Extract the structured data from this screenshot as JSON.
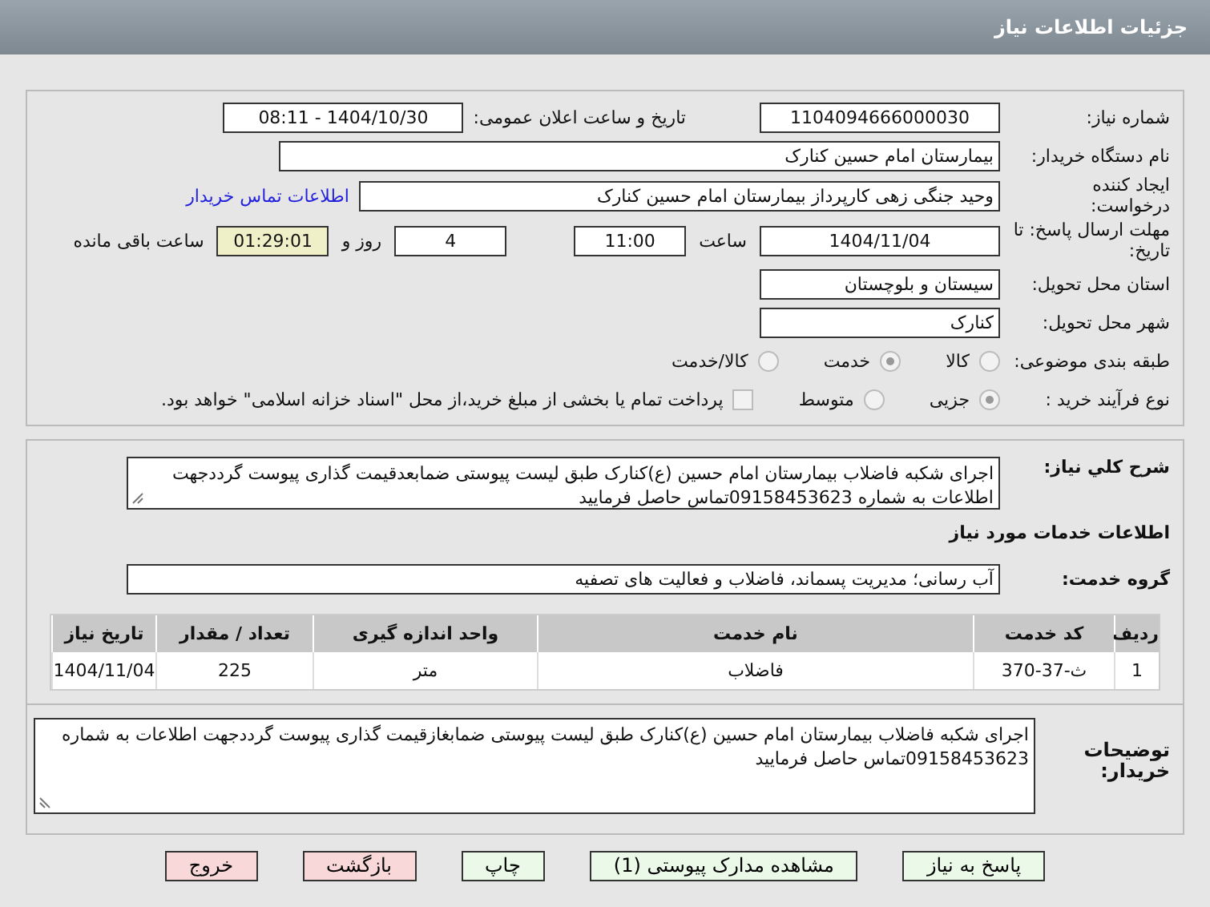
{
  "header": {
    "title": "جزئیات اطلاعات نیاز"
  },
  "details": {
    "need_number": {
      "label": "شماره نیاز:",
      "value": "1104094666000030"
    },
    "announce": {
      "label": "تاریخ و ساعت اعلان عمومی:",
      "value": "1404/10/30 - 08:11"
    },
    "buyer": {
      "label": "نام دستگاه خریدار:",
      "value": "بیمارستان امام حسین کنارک"
    },
    "creator": {
      "label": "ایجاد کننده درخواست:",
      "value": "وحید  جنگی زهی کارپرداز بیمارستان امام حسین کنارک",
      "link": "اطلاعات تماس خریدار"
    },
    "deadline": {
      "label": "مهلت ارسال پاسخ: تا تاریخ:",
      "date": "1404/11/04",
      "time_label": "ساعت",
      "time": "11:00",
      "days": "4",
      "days_label": "روز و",
      "remaining": "01:29:01",
      "remaining_label": "ساعت باقی مانده"
    },
    "province": {
      "label": "استان محل تحویل:",
      "value": "سیستان و بلوچستان"
    },
    "city": {
      "label": "شهر محل تحویل:",
      "value": "کنارک"
    },
    "category": {
      "label": "طبقه بندی موضوعی:",
      "options": [
        {
          "label": "کالا",
          "selected": false
        },
        {
          "label": "خدمت",
          "selected": true
        },
        {
          "label": "کالا/خدمت",
          "selected": false
        }
      ]
    },
    "process": {
      "label": "نوع فرآیند خرید :",
      "options": [
        {
          "label": "جزیی",
          "selected": true
        },
        {
          "label": "متوسط",
          "selected": false
        }
      ],
      "payment": {
        "checked": false,
        "text": "پرداخت تمام یا بخشی از مبلغ خرید،از محل \"اسناد خزانه اسلامی\" خواهد بود."
      }
    }
  },
  "description": {
    "label": "شرح کلي نیاز:",
    "value": "اجرای شکبه فاضلاب بیمارستان امام حسین (ع)کنارک طبق لیست پیوستی ضمابعدقیمت گذاری پیوست گرددجهت اطلاعات به شماره 09158453623تماس حاصل فرمایید"
  },
  "services": {
    "title": "اطلاعات خدمات مورد نیاز",
    "group_label": "گروه خدمت:",
    "group": "آب رسانی؛ مدیریت پسماند، فاضلاب و فعالیت های تصفیه",
    "table": {
      "columns": [
        "ردیف",
        "کد خدمت",
        "نام خدمت",
        "واحد اندازه گیری",
        "تعداد / مقدار",
        "تاریخ نیاز"
      ],
      "rows": [
        [
          "1",
          "ث-37-370",
          "فاضلاب",
          "متر",
          "225",
          "1404/11/04"
        ]
      ]
    }
  },
  "notes": {
    "label": "توضیحات خریدار:",
    "value": "اجرای شکبه فاضلاب بیمارستان امام حسین (ع)کنارک طبق لیست پیوستی ضمابغازقیمت گذاری پیوست گرددجهت اطلاعات به شماره 09158453623تماس حاصل فرمایید"
  },
  "buttons": [
    {
      "label": "پاسخ به نیاز",
      "kind": "normal"
    },
    {
      "label": "مشاهده مدارک پیوستی (1)",
      "kind": "normal"
    },
    {
      "label": "چاپ",
      "kind": "normal"
    },
    {
      "label": "بازگشت",
      "kind": "danger"
    },
    {
      "label": "خروج",
      "kind": "danger"
    }
  ]
}
